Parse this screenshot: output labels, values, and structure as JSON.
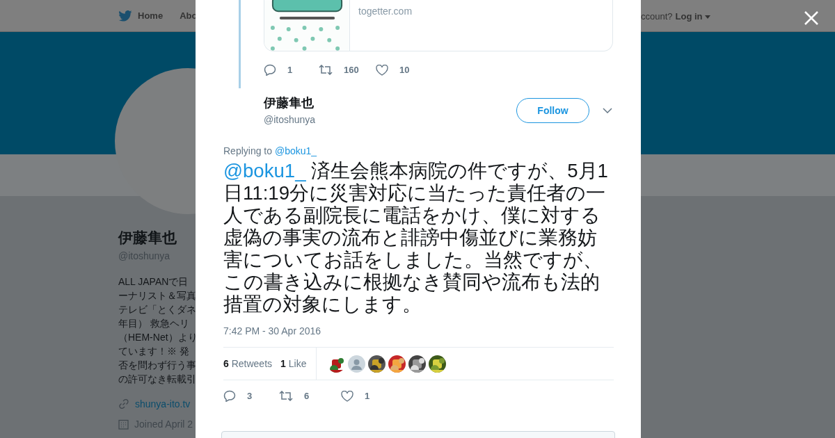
{
  "nav": {
    "items": [
      {
        "label": "Home",
        "kind": "home"
      },
      {
        "label": "Abo",
        "kind": "text"
      }
    ],
    "account_prompt": "ccount?",
    "login": "Log in"
  },
  "profile": {
    "name": "伊藤隼也",
    "handle": "@itoshunya",
    "bio_lines": [
      "ALL JAPANで日",
      "ーナリスト＆写真",
      "テレビ「とくダネ",
      "年目） 救急ヘリ",
      "（HEM-Net）より",
      "ています！※ 発",
      "否を問わず行う事",
      "の許可なき転載引"
    ],
    "website": "shunya-ito.tv",
    "joined": "Joined April 2"
  },
  "modal": {
    "quoted_card": {
      "domain": "togetter.com"
    },
    "parent_actions": [
      {
        "kind": "reply",
        "count": "1"
      },
      {
        "kind": "retweet",
        "count": "160"
      },
      {
        "kind": "like",
        "count": "10"
      }
    ],
    "tweet": {
      "author": "伊藤隼也",
      "handle": "@itoshunya",
      "follow_label": "Follow",
      "replying_to_label": "Replying to",
      "replying_to": "@boku1_",
      "mention": "@boku1_",
      "text": "済生会熊本病院の件ですが、5月1日11:19分に災害対応に当たった責任者の一人である副院長に電話をかけ、僕に対する虚偽の事実の流布と誹謗中傷並びに業務妨害についてお話をしました。当然ですが、この書き込みに根拠なき賛同や流布も法的措置の対象にします。",
      "timestamp": "7:42 PM - 30 Apr 2016",
      "stats": [
        {
          "count": "6",
          "label": "Retweets"
        },
        {
          "count": "1",
          "label": "Like"
        }
      ],
      "liker_avatars": [
        {
          "kind": "picture"
        },
        {
          "kind": "default"
        },
        {
          "kind": "picture"
        },
        {
          "kind": "picture"
        },
        {
          "kind": "picture"
        },
        {
          "kind": "picture"
        }
      ],
      "actions": [
        {
          "kind": "reply",
          "count": "3"
        },
        {
          "kind": "retweet",
          "count": "6"
        },
        {
          "kind": "like",
          "count": "1"
        }
      ]
    }
  }
}
